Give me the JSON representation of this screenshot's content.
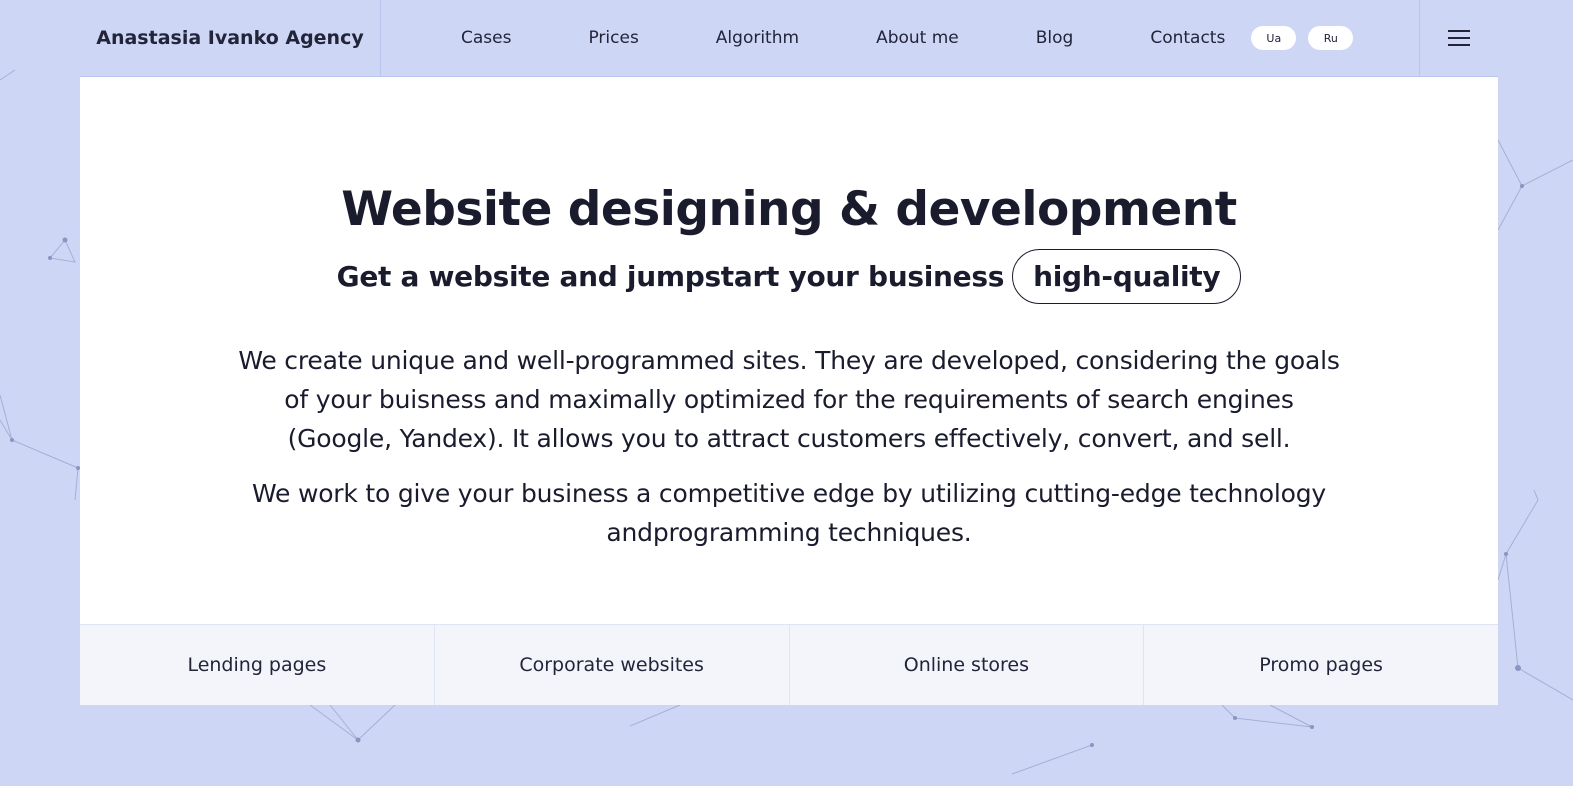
{
  "header": {
    "brand": "Anastasia Ivanko Agency",
    "nav": [
      "Cases",
      "Prices",
      "Algorithm",
      "About me",
      "Blog",
      "Contacts"
    ],
    "languages": [
      "Ua",
      "Ru"
    ]
  },
  "hero": {
    "title": "Website designing & development",
    "subtitle": "Get a website and jumpstart your business",
    "pill": "high-quality",
    "paragraph1": "We create unique and well-programmed sites. They are developed, considering the goals of your buisness and maximally optimized for the requirements of search engines (Google, Yandex). It allows you to attract customers effectively, convert, and sell.",
    "paragraph2": "We work to give your business a competitive edge by utilizing cutting-edge technology andprogramming techniques."
  },
  "services": [
    "Lending pages",
    "Corporate websites",
    "Online stores",
    "Promo pages"
  ],
  "colors": {
    "background": "#cdd7f5",
    "text": "#1a1c2e",
    "services_bg": "#f3f5fb"
  }
}
